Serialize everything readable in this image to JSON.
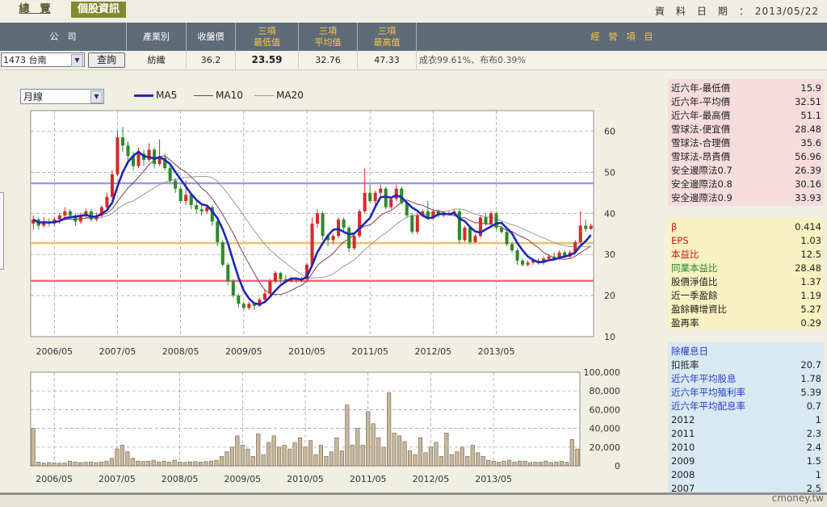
{
  "tabs": {
    "overview": "總　覽",
    "stock_info": "個股資訊"
  },
  "date_label": "資　料　日　期　：　2013/05/22",
  "table": {
    "headers": {
      "company": "公　司",
      "industry": "產業別",
      "close": "收盤價",
      "low_l1": "三項",
      "low_l2": "最低值",
      "avg_l1": "三項",
      "avg_l2": "平均值",
      "high_l1": "三項",
      "high_l2": "最高值",
      "business": "經　營　項　目"
    },
    "row": {
      "company_select": "1473 台南",
      "query_button": "查詢",
      "industry": "紡織",
      "close": "36.2",
      "low": "23.59",
      "avg": "32.76",
      "high": "47.33",
      "business": "成衣99.61%、布布0.39%"
    }
  },
  "period_select": "月線",
  "legend": [
    {
      "name": "MA5",
      "color": "#1c28b4"
    },
    {
      "name": "MA10",
      "color": "#8a3a52"
    },
    {
      "name": "MA20",
      "color": "#9a9a9a"
    }
  ],
  "colors": {
    "up": "#d42a2a",
    "down": "#2a8a2a",
    "ref_purple": "#9a9ae8",
    "ref_orange": "#f3be6a",
    "ref_red": "#ea6a7e"
  },
  "chart_data": [
    {
      "type": "candlestick",
      "x_ticks": [
        "2006/05",
        "2007/05",
        "2008/05",
        "2009/05",
        "2010/05",
        "2011/05",
        "2012/05",
        "2013/05"
      ],
      "y_ticks": [
        10,
        20,
        30,
        40,
        50,
        60
      ],
      "ylim": [
        10,
        65
      ],
      "ref_lines": [
        47.33,
        32.76,
        23.59
      ],
      "start": "2006/01",
      "candles": [
        [
          37.5,
          38.5,
          36.0,
          39.5
        ],
        [
          38.5,
          37.0,
          36.0,
          39.0
        ],
        [
          37.0,
          38.0,
          36.5,
          39.0
        ],
        [
          38.0,
          37.5,
          36.8,
          38.8
        ],
        [
          37.5,
          38.5,
          36.9,
          39.2
        ],
        [
          38.5,
          39.5,
          37.5,
          40.0
        ],
        [
          39.5,
          40.5,
          38.5,
          41.5
        ],
        [
          40.5,
          39.5,
          38.5,
          41.0
        ],
        [
          39.5,
          38.0,
          37.0,
          40.0
        ],
        [
          38.0,
          39.5,
          37.5,
          40.2
        ],
        [
          39.5,
          40.5,
          38.8,
          41.2
        ],
        [
          40.5,
          38.5,
          38.0,
          41.0
        ],
        [
          38.5,
          39.5,
          38.0,
          40.2
        ],
        [
          39.5,
          41.5,
          39.0,
          42.0
        ],
        [
          41.5,
          44.0,
          41.0,
          45.0
        ],
        [
          44.0,
          49.5,
          43.5,
          50.5
        ],
        [
          49.5,
          58.5,
          49.0,
          60.0
        ],
        [
          58.5,
          56.5,
          55.0,
          61.0
        ],
        [
          56.5,
          54.0,
          52.0,
          57.5
        ],
        [
          54.0,
          51.5,
          50.5,
          55.0
        ],
        [
          51.5,
          54.5,
          51.0,
          56.0
        ],
        [
          54.5,
          53.0,
          51.5,
          55.5
        ],
        [
          53.0,
          55.5,
          52.5,
          57.0
        ],
        [
          55.5,
          52.0,
          51.0,
          56.0
        ],
        [
          52.0,
          53.5,
          51.5,
          58.0
        ],
        [
          53.5,
          51.0,
          50.5,
          54.5
        ],
        [
          51.0,
          48.0,
          47.5,
          52.0
        ],
        [
          48.0,
          46.0,
          45.0,
          48.5
        ],
        [
          46.0,
          43.0,
          42.5,
          46.5
        ],
        [
          43.0,
          44.5,
          42.0,
          48.0
        ],
        [
          44.5,
          42.0,
          41.0,
          45.0
        ],
        [
          42.0,
          41.0,
          40.0,
          43.0
        ],
        [
          41.0,
          40.5,
          39.5,
          42.0
        ],
        [
          40.5,
          41.5,
          40.0,
          42.0
        ],
        [
          41.5,
          38.0,
          37.0,
          42.0
        ],
        [
          38.0,
          33.0,
          32.0,
          38.5
        ],
        [
          33.0,
          27.5,
          27.0,
          33.5
        ],
        [
          27.5,
          23.5,
          22.5,
          28.0
        ],
        [
          23.5,
          20.0,
          19.5,
          24.0
        ],
        [
          20.0,
          18.0,
          17.0,
          20.5
        ],
        [
          18.0,
          17.0,
          16.5,
          18.5
        ],
        [
          17.0,
          18.0,
          16.5,
          18.5
        ],
        [
          18.0,
          17.5,
          16.5,
          18.2
        ],
        [
          17.5,
          19.0,
          17.2,
          19.5
        ],
        [
          19.0,
          20.5,
          18.5,
          21.5
        ],
        [
          20.5,
          23.5,
          20.0,
          24.0
        ],
        [
          23.5,
          25.5,
          23.0,
          26.0
        ],
        [
          25.5,
          24.0,
          23.0,
          25.8
        ],
        [
          24.0,
          23.5,
          23.0,
          25.0
        ],
        [
          23.5,
          24.0,
          23.2,
          24.6
        ],
        [
          24.0,
          23.8,
          23.0,
          24.3
        ],
        [
          23.8,
          24.0,
          23.2,
          24.5
        ],
        [
          24.0,
          27.5,
          23.7,
          28.0
        ],
        [
          27.5,
          37.5,
          27.0,
          39.0
        ],
        [
          37.5,
          40.0,
          36.5,
          41.0
        ],
        [
          40.0,
          34.5,
          33.5,
          40.5
        ],
        [
          34.5,
          33.5,
          32.0,
          35.0
        ],
        [
          33.5,
          34.5,
          32.5,
          35.0
        ],
        [
          34.5,
          38.5,
          34.0,
          39.0
        ],
        [
          38.5,
          36.5,
          35.5,
          39.0
        ],
        [
          36.5,
          31.5,
          30.5,
          37.0
        ],
        [
          31.5,
          34.5,
          31.0,
          35.0
        ],
        [
          34.5,
          40.5,
          34.0,
          41.0
        ],
        [
          40.5,
          45.0,
          40.0,
          51.0
        ],
        [
          45.0,
          43.0,
          42.5,
          47.0
        ],
        [
          43.0,
          45.0,
          42.0,
          45.5
        ],
        [
          45.0,
          46.0,
          44.0,
          47.0
        ],
        [
          46.0,
          41.5,
          41.0,
          46.5
        ],
        [
          41.5,
          43.5,
          41.0,
          44.0
        ],
        [
          43.5,
          46.0,
          43.0,
          47.0
        ],
        [
          46.0,
          42.5,
          42.0,
          46.5
        ],
        [
          42.5,
          39.5,
          39.0,
          43.0
        ],
        [
          39.5,
          35.5,
          35.0,
          40.0
        ],
        [
          35.5,
          39.5,
          35.0,
          40.0
        ],
        [
          39.5,
          40.5,
          39.0,
          41.0
        ],
        [
          40.5,
          39.0,
          38.5,
          43.0
        ],
        [
          39.0,
          40.5,
          38.5,
          41.0
        ],
        [
          40.5,
          39.5,
          39.0,
          41.0
        ],
        [
          39.5,
          40.0,
          39.0,
          40.5
        ],
        [
          40.0,
          40.0,
          39.5,
          40.5
        ],
        [
          40.0,
          40.5,
          39.5,
          41.0
        ],
        [
          40.5,
          33.5,
          32.5,
          41.0
        ],
        [
          33.5,
          36.5,
          33.0,
          37.0
        ],
        [
          36.5,
          33.0,
          32.5,
          37.0
        ],
        [
          33.0,
          34.5,
          32.8,
          35.0
        ],
        [
          34.5,
          39.0,
          34.0,
          39.5
        ],
        [
          39.0,
          37.5,
          37.0,
          40.0
        ],
        [
          37.5,
          40.0,
          37.0,
          40.5
        ],
        [
          40.0,
          36.5,
          36.0,
          40.5
        ],
        [
          36.5,
          35.5,
          35.0,
          37.0
        ],
        [
          35.5,
          32.5,
          32.0,
          36.0
        ],
        [
          32.5,
          31.0,
          30.5,
          33.0
        ],
        [
          31.0,
          28.5,
          27.5,
          31.5
        ],
        [
          28.5,
          27.5,
          27.0,
          29.0
        ],
        [
          27.5,
          28.0,
          27.0,
          28.5
        ],
        [
          28.0,
          28.5,
          27.5,
          29.0
        ],
        [
          28.5,
          28.0,
          27.5,
          29.0
        ],
        [
          28.0,
          29.0,
          27.5,
          29.5
        ],
        [
          29.0,
          29.5,
          28.5,
          30.0
        ],
        [
          29.5,
          29.0,
          28.8,
          30.5
        ],
        [
          29.0,
          30.5,
          28.7,
          31.0
        ],
        [
          30.5,
          29.5,
          29.0,
          31.0
        ],
        [
          29.5,
          30.5,
          29.0,
          31.0
        ],
        [
          30.5,
          33.0,
          30.0,
          33.5
        ],
        [
          33.0,
          37.0,
          32.5,
          40.5
        ],
        [
          37.0,
          36.2,
          35.5,
          38.5
        ],
        [
          36.2,
          37.0,
          36.0,
          37.5
        ]
      ]
    },
    {
      "type": "bar",
      "x_ticks": [
        "2006/05",
        "2007/05",
        "2008/05",
        "2009/05",
        "2010/05",
        "2011/05",
        "2012/05",
        "2013/05"
      ],
      "y_ticks": [
        "0",
        "20,000",
        "40,000",
        "60,000",
        "80,000",
        "100,000"
      ],
      "ylim": [
        0,
        100000
      ],
      "values": [
        40000,
        4000,
        3000,
        3500,
        3200,
        2800,
        3000,
        5000,
        4000,
        3500,
        3800,
        4200,
        3500,
        4000,
        5000,
        8000,
        18000,
        22000,
        15000,
        8000,
        5000,
        4500,
        5000,
        6000,
        4200,
        5000,
        4000,
        6000,
        4000,
        3800,
        4200,
        4600,
        4000,
        4500,
        5000,
        6000,
        10000,
        15000,
        20000,
        32000,
        22000,
        18000,
        10000,
        34000,
        12000,
        25000,
        32000,
        20000,
        22000,
        18000,
        25000,
        30000,
        20000,
        27000,
        12000,
        22000,
        10000,
        15000,
        30000,
        16000,
        65000,
        22000,
        40000,
        22000,
        58000,
        45000,
        30000,
        20000,
        78000,
        35000,
        32000,
        26000,
        16000,
        12000,
        30000,
        14000,
        20000,
        25000,
        10000,
        35000,
        12000,
        15000,
        20000,
        10000,
        22000,
        14000,
        10000,
        6000,
        5000,
        4000,
        5000,
        6000,
        4000,
        5000,
        5000,
        3500,
        4000,
        4000,
        5000,
        3500,
        4000,
        5000,
        4000,
        28000,
        18000
      ]
    }
  ],
  "metrics_box1": [
    {
      "k": "近六年-最低價",
      "v": "15.9"
    },
    {
      "k": "近六年-平均價",
      "v": "32.51"
    },
    {
      "k": "近六年-最高價",
      "v": "51.1"
    },
    {
      "k": "雪球法-便宜價",
      "v": "28.48"
    },
    {
      "k": "雪球法-合理價",
      "v": "35.6"
    },
    {
      "k": "雪球法-昂貴價",
      "v": "56.96"
    },
    {
      "k": "安全邊際法0.7",
      "v": "26.39"
    },
    {
      "k": "安全邊際法0.8",
      "v": "30.16"
    },
    {
      "k": "安全邊際法0.9",
      "v": "33.93"
    }
  ],
  "metrics_box2": [
    {
      "k": "β",
      "v": "0.414",
      "c": "#c01a1a"
    },
    {
      "k": "EPS",
      "v": "1.03",
      "c": "#c01a1a"
    },
    {
      "k": "本益比",
      "v": "12.5",
      "c": "#c01a1a"
    },
    {
      "k": "同業本益比",
      "v": "28.48",
      "c": "#1f8a2a"
    },
    {
      "k": "股價淨值比",
      "v": "1.37",
      "c": "#222"
    },
    {
      "k": "近一季盈餘",
      "v": "1.19",
      "c": "#222"
    },
    {
      "k": "盈餘轉增資比",
      "v": "5.27",
      "c": "#222"
    },
    {
      "k": "盈再率",
      "v": "0.29",
      "c": "#222"
    }
  ],
  "metrics_box3": [
    {
      "k": "除權息日",
      "v": "",
      "c": "#2a3ac8"
    },
    {
      "k": "扣抵率",
      "v": "20.7",
      "c": "#222"
    },
    {
      "k": "近六年平均股息",
      "v": "1.78",
      "c": "#2a3ac8"
    },
    {
      "k": "近六年平均殖利率",
      "v": "5.39",
      "c": "#2a3ac8"
    },
    {
      "k": "近六年平均配息率",
      "v": "0.7",
      "c": "#2a3ac8"
    },
    {
      "k": "2012",
      "v": "1",
      "c": "#222"
    },
    {
      "k": "2011",
      "v": "2.3",
      "c": "#222"
    },
    {
      "k": "2010",
      "v": "2.4",
      "c": "#222"
    },
    {
      "k": "2009",
      "v": "1.5",
      "c": "#222"
    },
    {
      "k": "2008",
      "v": "1",
      "c": "#222"
    },
    {
      "k": "2007",
      "v": "2.5",
      "c": "#222"
    }
  ],
  "watermark": "cmoney.tw"
}
